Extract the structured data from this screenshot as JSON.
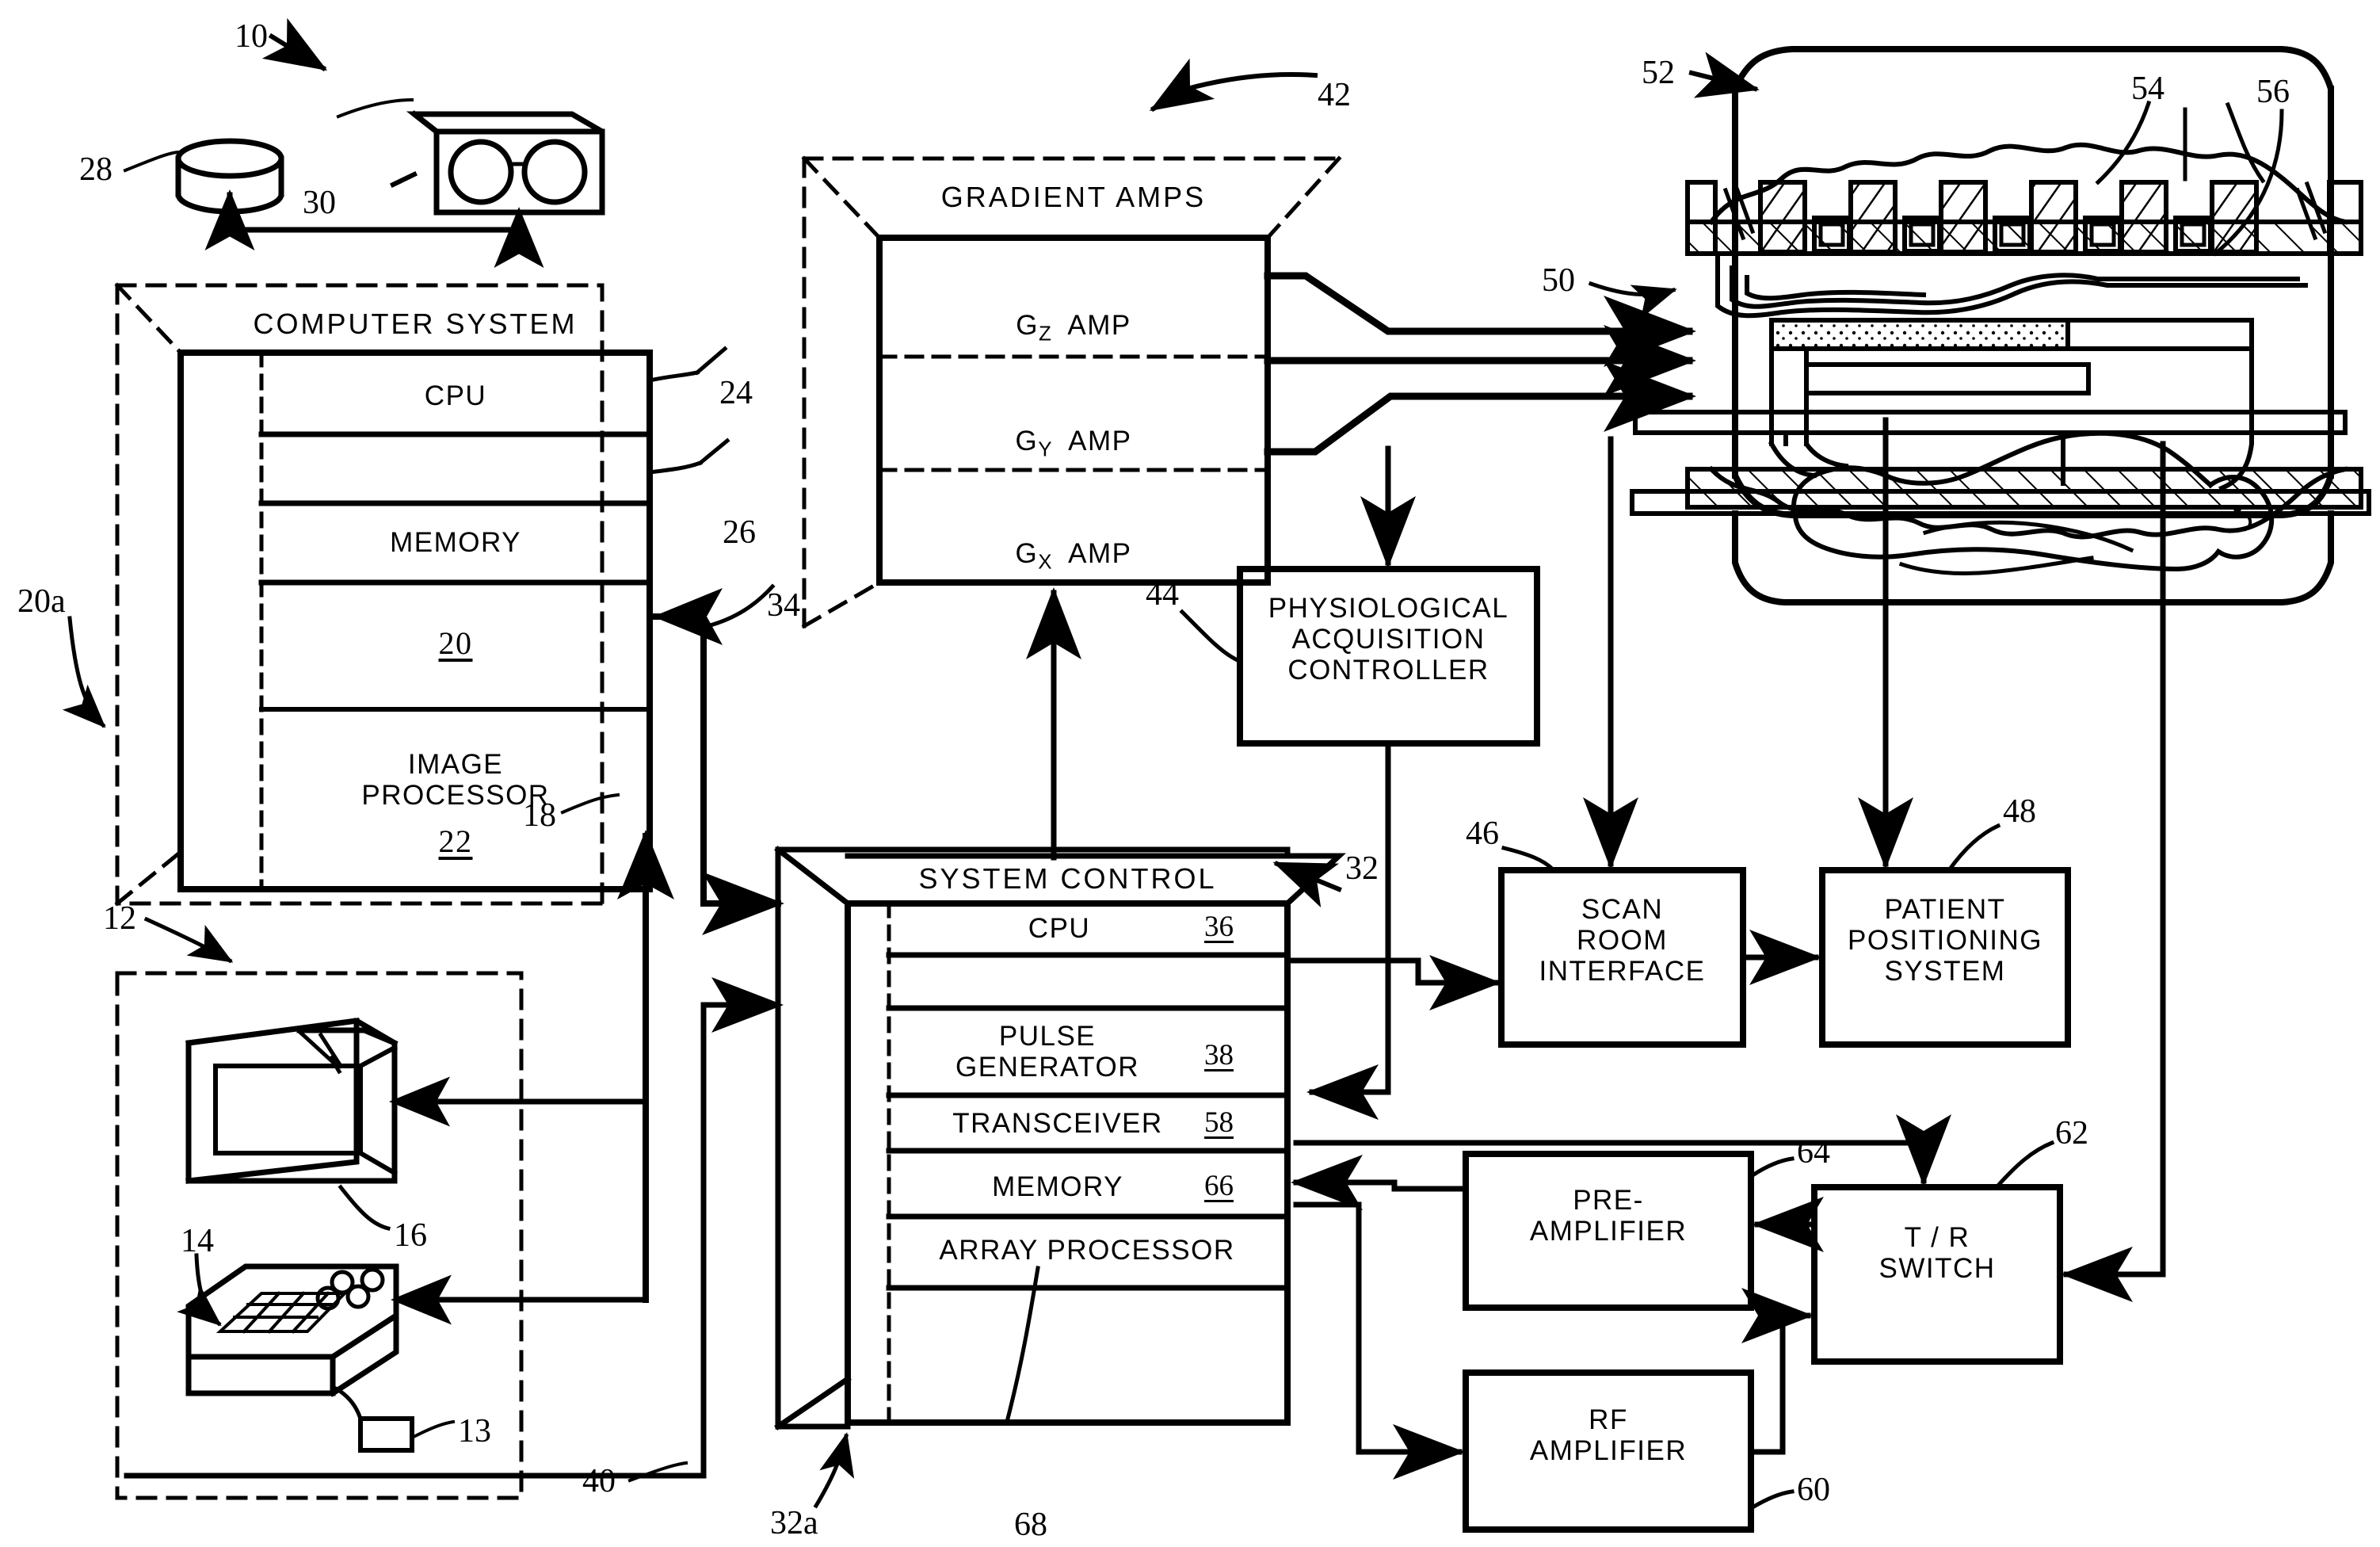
{
  "figure": {
    "type": "MRI system block diagram",
    "ref_10": "10",
    "ref_12": "12",
    "ref_13": "13",
    "ref_14": "14",
    "ref_16": "16",
    "ref_18": "18",
    "ref_20a": "20a",
    "ref_24": "24",
    "ref_26": "26",
    "ref_28": "28",
    "ref_30": "30",
    "ref_32": "32",
    "ref_32a": "32a",
    "ref_34": "34",
    "ref_40": "40",
    "ref_42": "42",
    "ref_44": "44",
    "ref_46": "46",
    "ref_48": "48",
    "ref_50": "50",
    "ref_52": "52",
    "ref_54": "54",
    "ref_56": "56",
    "ref_60": "60",
    "ref_62": "62",
    "ref_64": "64"
  },
  "computer_system": {
    "title": "COMPUTER  SYSTEM",
    "rows": [
      {
        "label": "CPU",
        "num": ""
      },
      {
        "label": "MEMORY",
        "num": ""
      },
      {
        "label": "20",
        "num": ""
      },
      {
        "label": "IMAGE\nPROCESSOR",
        "num": "22"
      }
    ],
    "cpu_ref": "24",
    "memory_ref": "26",
    "system_num": "20",
    "image_processor_num": "22"
  },
  "gradient_amps": {
    "title": "GRADIENT AMPS",
    "rows": [
      {
        "g": "G",
        "axis": "Z",
        "amp": "AMP"
      },
      {
        "g": "G",
        "axis": "Y",
        "amp": "AMP"
      },
      {
        "g": "G",
        "axis": "X",
        "amp": "AMP"
      }
    ]
  },
  "system_control": {
    "title": "SYSTEM   CONTROL",
    "rows": [
      {
        "label": "CPU",
        "num": "36"
      },
      {
        "label": "PULSE\nGENERATOR",
        "num": "38"
      },
      {
        "label": "TRANSCEIVER",
        "num": "58"
      },
      {
        "label": "MEMORY",
        "num": "66"
      },
      {
        "label": "ARRAY  PROCESSOR",
        "num": ""
      }
    ],
    "array_processor_ref": "68"
  },
  "boxes": {
    "physiological": "PHYSIOLOGICAL\nACQUISITION\nCONTROLLER",
    "scan_room": "SCAN\nROOM\nINTERFACE",
    "patient_positioning": "PATIENT\nPOSITIONING\nSYSTEM",
    "pre_amplifier": "PRE-\nAMPLIFIER",
    "tr_switch": "T / R\nSWITCH",
    "rf_amplifier": "RF\nAMPLIFIER"
  },
  "colors": {
    "ink": "#000000",
    "paper": "#ffffff"
  }
}
